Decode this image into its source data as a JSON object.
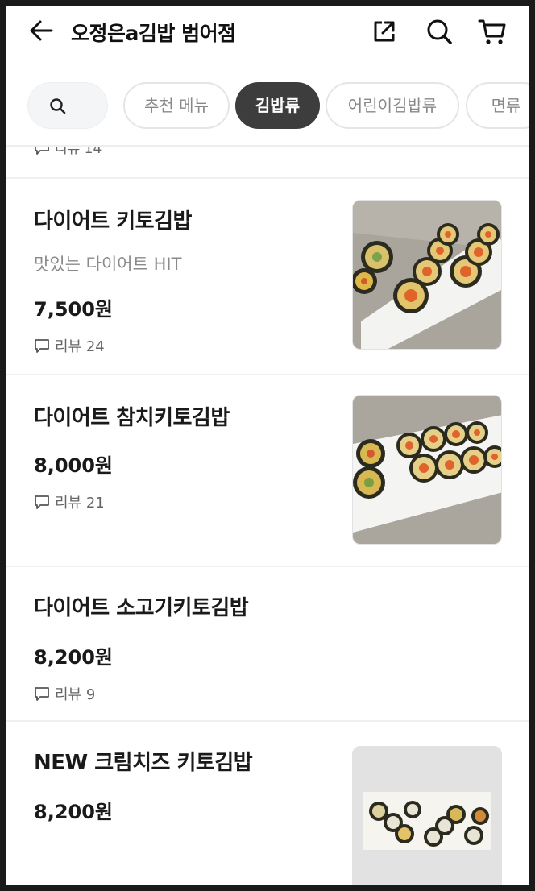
{
  "header": {
    "title": "오정은a김밥 범어점",
    "back_icon": "arrow-left-icon",
    "share_icon": "share-icon",
    "search_icon": "search-icon",
    "cart_icon": "cart-icon"
  },
  "tabs": {
    "search_icon": "search-icon",
    "items": [
      {
        "label": "추천 메뉴",
        "active": false
      },
      {
        "label": "김밥류",
        "active": true
      },
      {
        "label": "어린이김밥류",
        "active": false
      },
      {
        "label": "면류",
        "active": false
      }
    ]
  },
  "partial_item": {
    "review": "리뷰 14"
  },
  "menu": [
    {
      "name": "다이어트 키토김밥",
      "desc": "맛있는 다이어트 HIT",
      "price": "7,500원",
      "review": "리뷰 24",
      "has_image": true
    },
    {
      "name": "다이어트 참치키토김밥",
      "price": "8,000원",
      "review": "리뷰 21",
      "has_image": true
    },
    {
      "name": "다이어트 소고기키토김밥",
      "price": "8,200원",
      "review": "리뷰 9",
      "has_image": false
    },
    {
      "name": "NEW 크림치즈 키토김밥",
      "price": "8,200원",
      "has_image": true
    }
  ],
  "colors": {
    "active_chip": "#3d3d3d",
    "chip_border": "#e3e5e8",
    "text_primary": "#1a1a1a",
    "text_secondary": "#8a8a8a"
  }
}
